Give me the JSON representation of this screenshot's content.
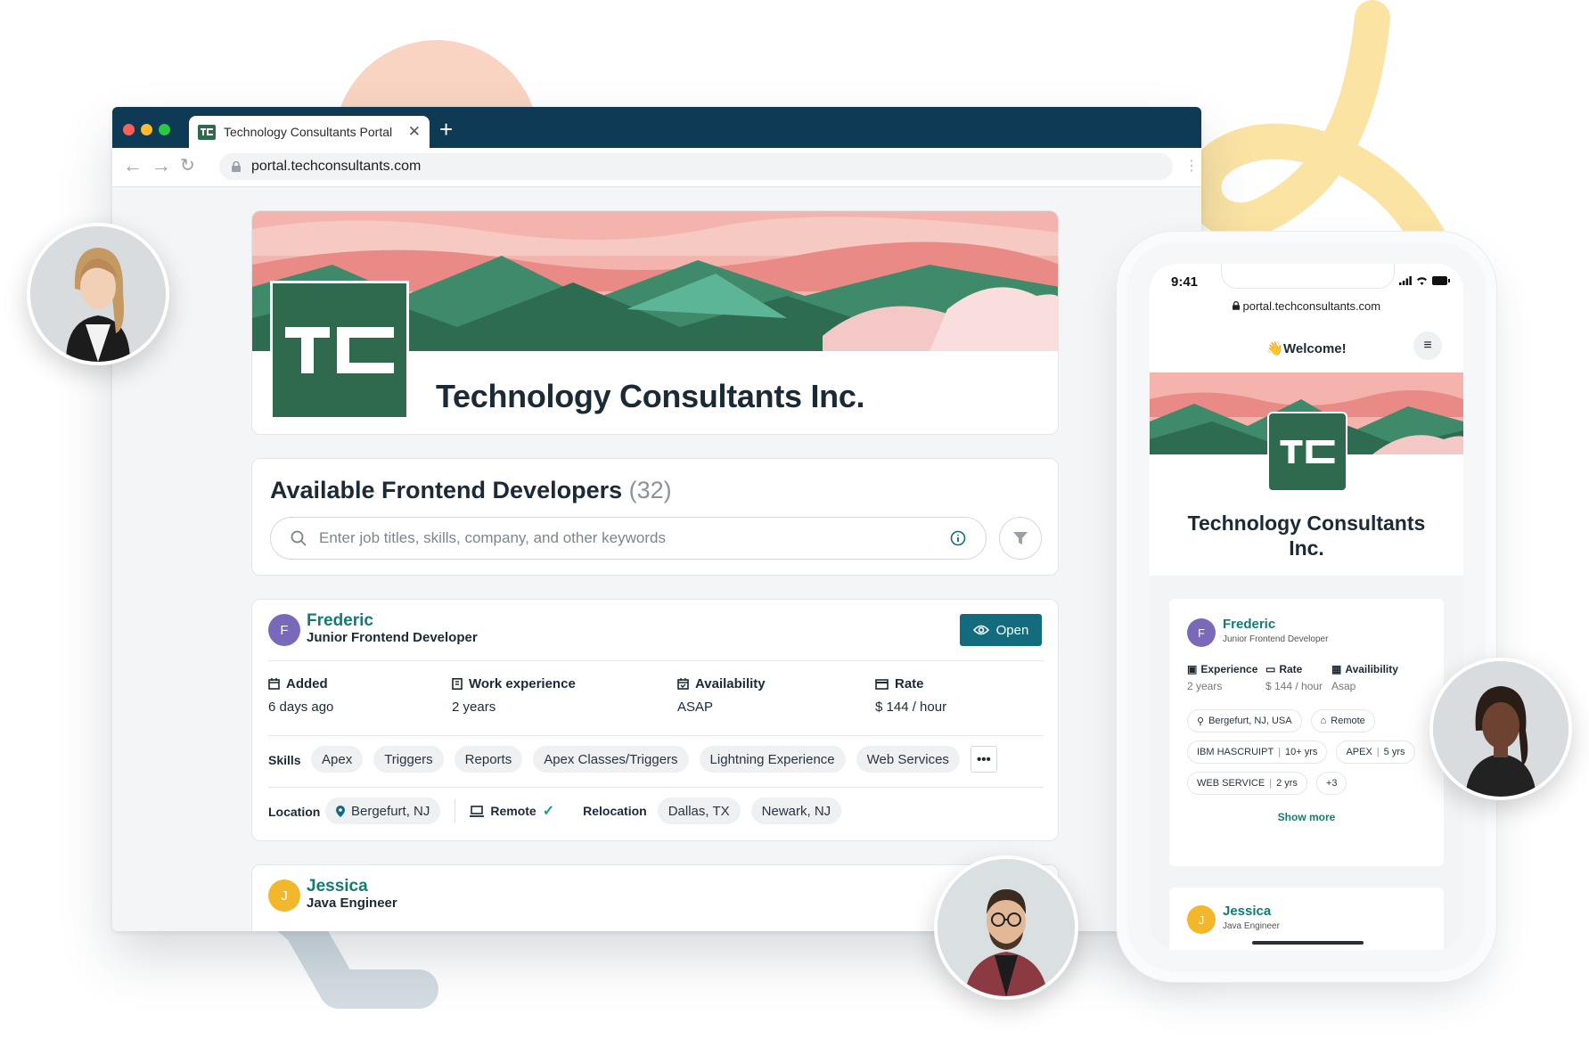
{
  "browser": {
    "tab_title": "Technology Consultants Portal",
    "address": "portal.techconsultants.com"
  },
  "company": {
    "name": "Technology Consultants Inc.",
    "logo_text": "TC",
    "brand_color": "#2f6a4e"
  },
  "listing": {
    "title": "Available Frontend Developers",
    "count": "(32)",
    "search_placeholder": "Enter job titles, skills, company, and other keywords"
  },
  "developers": [
    {
      "initial": "F",
      "name": "Frederic",
      "role": "Junior Frontend Developer",
      "open_label": "Open",
      "stats": [
        {
          "label": "Added",
          "value": "6 days ago",
          "icon": "calendar-icon"
        },
        {
          "label": "Work experience",
          "value": "2 years",
          "icon": "building-icon"
        },
        {
          "label": "Availability",
          "value": "ASAP",
          "icon": "calendar-check-icon"
        },
        {
          "label": "Rate",
          "value": "$ 144 / hour",
          "icon": "wallet-icon"
        }
      ],
      "skills_label": "Skills",
      "skills": [
        "Apex",
        "Triggers",
        "Reports",
        "Apex Classes/Triggers",
        "Lightning Experience",
        "Web Services"
      ],
      "location_label": "Location",
      "location": "Bergefurt, NJ",
      "remote_label": "Remote",
      "relocation_label": "Relocation",
      "relocation": [
        "Dallas, TX",
        "Newark, NJ"
      ]
    },
    {
      "initial": "J",
      "name": "Jessica",
      "role": "Java Engineer"
    }
  ],
  "phone": {
    "time": "9:41",
    "url": "portal.techconsultants.com",
    "welcome": "👋Welcome!",
    "company_name": "Technology Consultants Inc.",
    "card": {
      "initial": "F",
      "name": "Frederic",
      "role": "Junior Frontend Developer",
      "stats": [
        {
          "label": "Experience",
          "value": "2 years"
        },
        {
          "label": "Rate",
          "value": "$ 144 / hour"
        },
        {
          "label": "Availibility",
          "value": "Asap"
        }
      ],
      "location": "Bergefurt, NJ, USA",
      "remote": "Remote",
      "skills": [
        {
          "name": "IBM HASCRUIPT",
          "years": "10+ yrs"
        },
        {
          "name": "APEX",
          "years": "5 yrs"
        },
        {
          "name": "WEB SERVICE",
          "years": "2 yrs"
        }
      ],
      "extra": "+3",
      "show_more": "Show more"
    },
    "card2": {
      "initial": "J",
      "name": "Jessica",
      "role": "Java Engineer"
    }
  },
  "colors": {
    "navy": "#0e3a55",
    "teal": "#147a74",
    "button": "#126c7d",
    "avatar_purple": "#7a68b8",
    "avatar_yellow": "#f2b72b"
  }
}
